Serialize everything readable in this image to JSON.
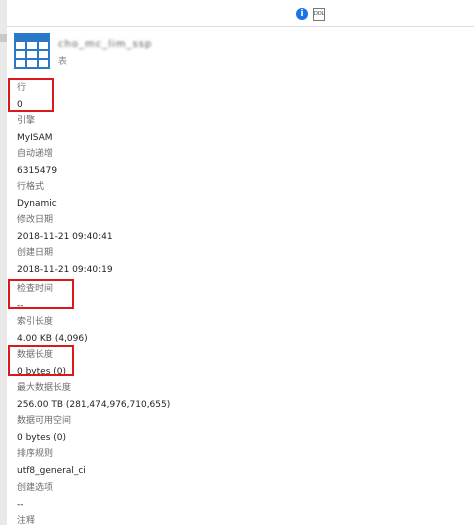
{
  "toolbar": {
    "info_icon": "info-icon",
    "ddl_icon": "ddl-icon"
  },
  "object": {
    "name": "cho_mc_lim_ssp",
    "type": "表"
  },
  "properties": [
    {
      "label": "行",
      "value": "0"
    },
    {
      "label": "引擎",
      "value": "MyISAM"
    },
    {
      "label": "自动递增",
      "value": "6315479"
    },
    {
      "label": "行格式",
      "value": "Dynamic"
    },
    {
      "label": "修改日期",
      "value": "2018-11-21 09:40:41"
    },
    {
      "label": "创建日期",
      "value": "2018-11-21 09:40:19"
    },
    {
      "label": "检查时间",
      "value": "--"
    },
    {
      "label": "索引长度",
      "value": "4.00 KB (4,096)"
    },
    {
      "label": "数据长度",
      "value": "0 bytes (0)"
    },
    {
      "label": "最大数据长度",
      "value": "256.00 TB (281,474,976,710,655)"
    },
    {
      "label": "数据可用空间",
      "value": "0 bytes (0)"
    },
    {
      "label": "排序规则",
      "value": "utf8_general_ci"
    },
    {
      "label": "创建选项",
      "value": "--"
    },
    {
      "label": "注释",
      "value": ""
    }
  ],
  "colors": {
    "highlight": "#d9191c",
    "table_icon": "#2b78c8",
    "info_icon": "#1a73e8"
  }
}
